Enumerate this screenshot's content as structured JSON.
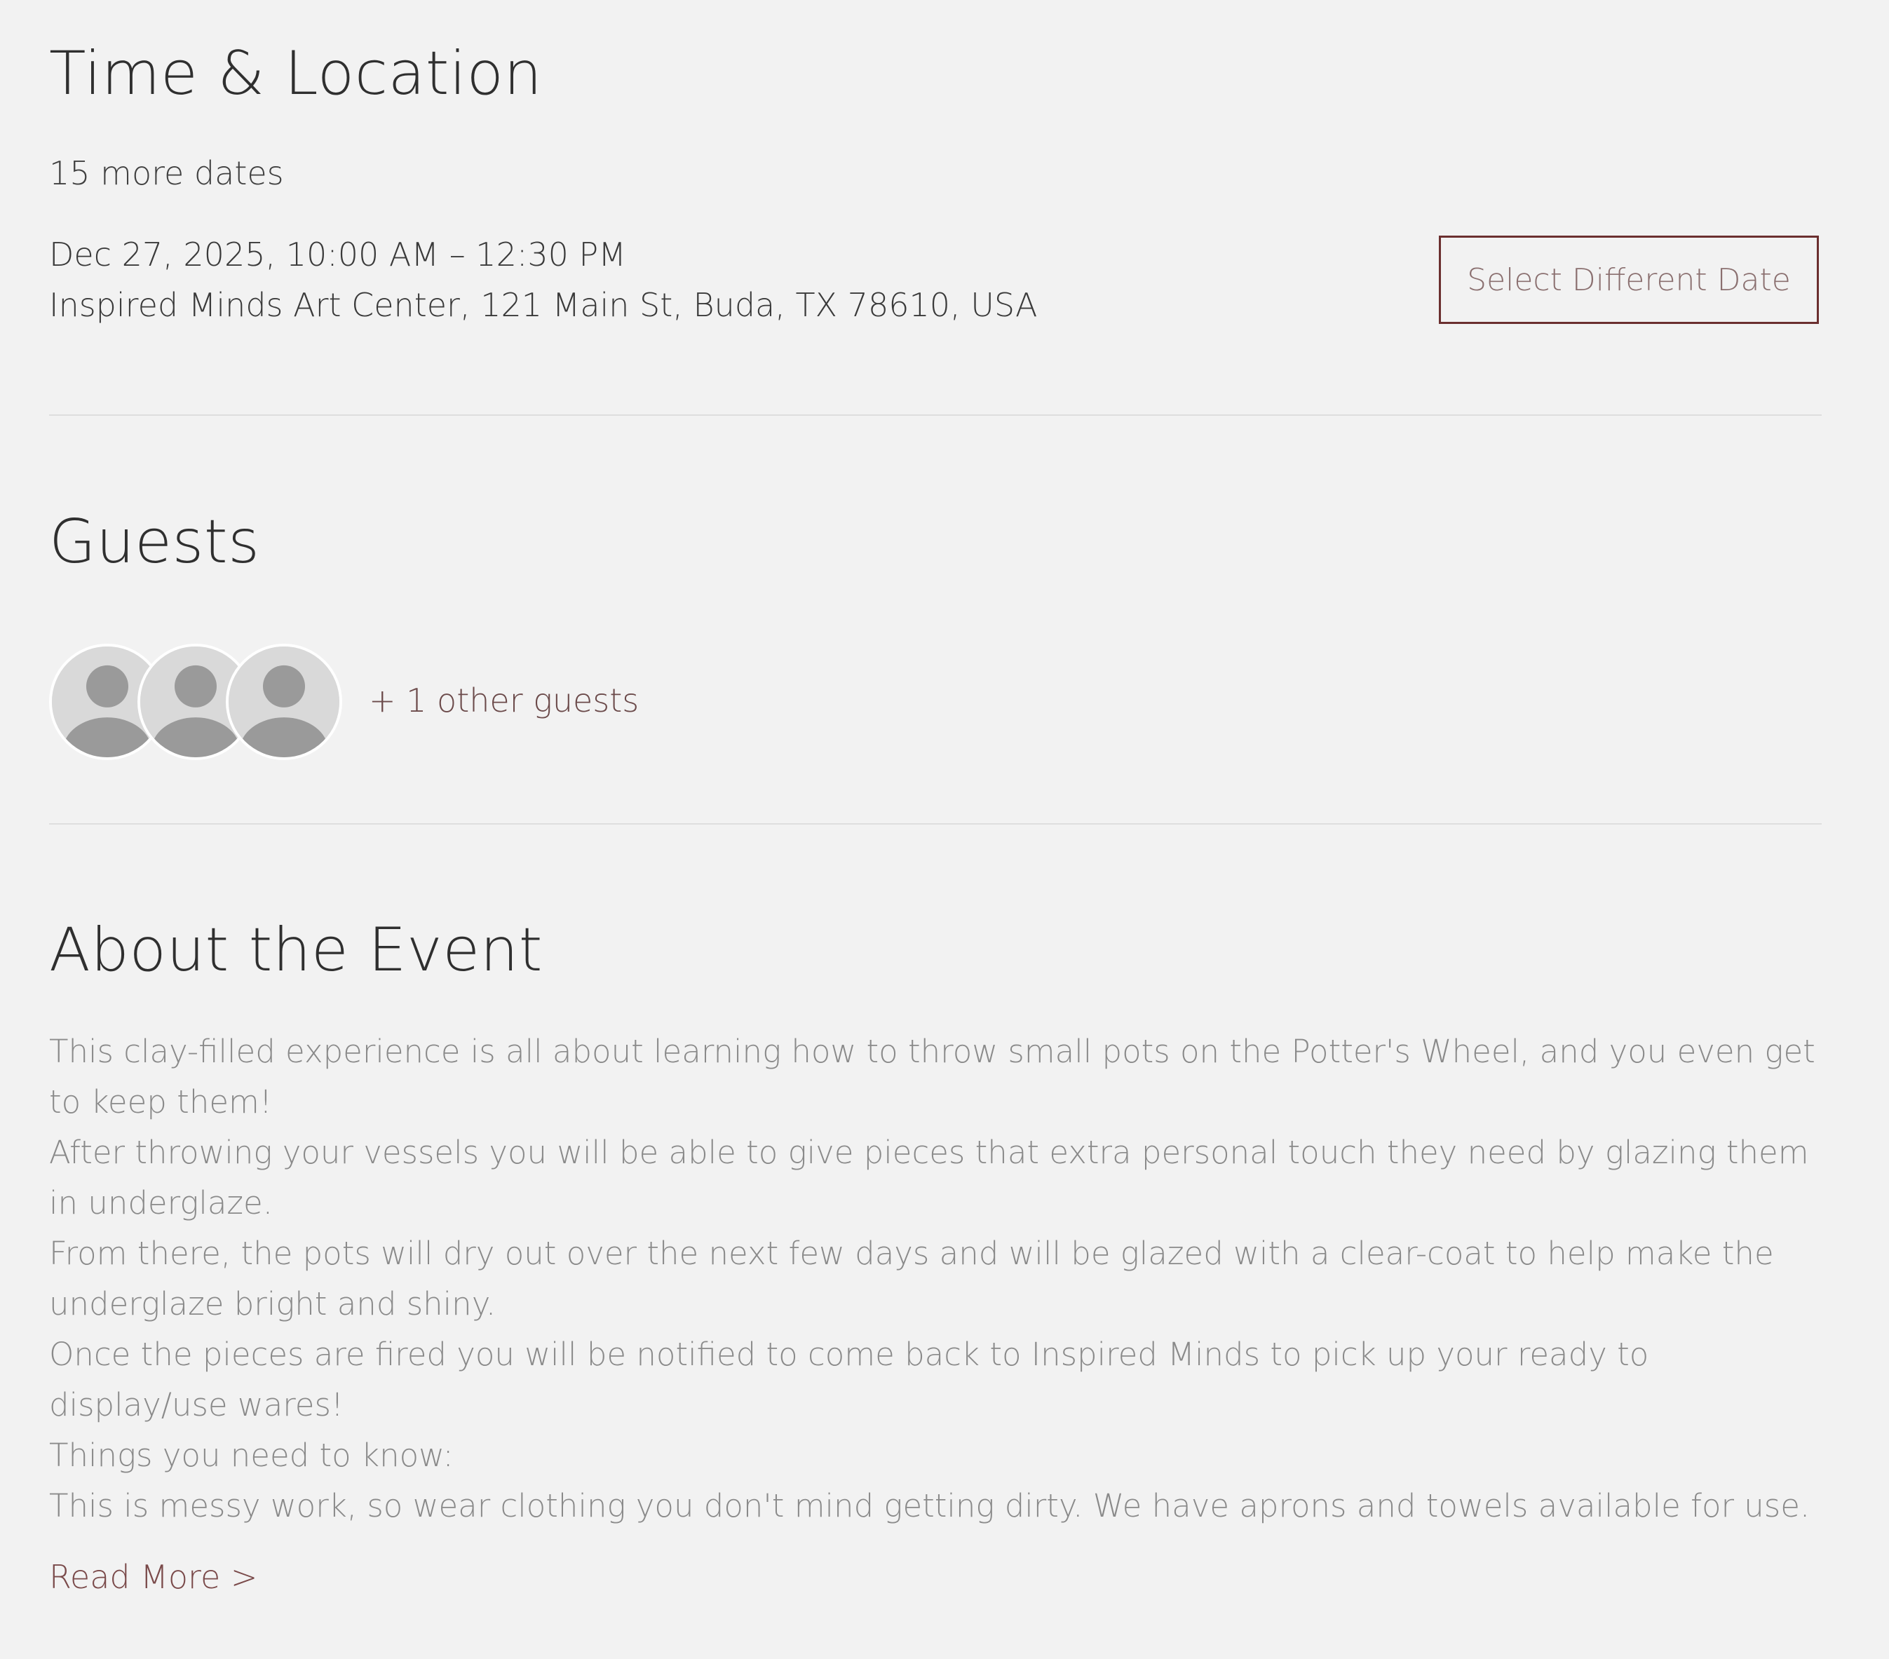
{
  "time_location": {
    "title": "Time & Location",
    "more_dates": "15 more dates",
    "datetime": "Dec 27, 2025, 10:00 AM – 12:30 PM",
    "location": "Inspired Minds Art Center, 121 Main St, Buda, TX 78610, USA",
    "select_date_label": "Select Different Date"
  },
  "guests": {
    "title": "Guests",
    "other_guests": "+ 1 other guests",
    "avatar_icon": "default-user-icon"
  },
  "about": {
    "title": "About the Event",
    "paragraphs": [
      "This clay-filled experience is all about learning how to throw small pots on the Potter's Wheel, and you even get to keep them!",
      "After throwing your vessels you will be able to give pieces that extra personal touch they need by glazing them in underglaze.",
      "From there, the pots will dry out over the next few days and will be glazed with a clear-coat to help make the underglaze bright and shiny.",
      "Once the pieces are fired you will be notified to come back to Inspired Minds to pick up your ready to display/use wares!",
      "Things you need to know:",
      "This is messy work, so wear clothing you don't mind getting dirty. We have aprons and towels available for use."
    ],
    "read_more": "Read More >"
  },
  "colors": {
    "background": "#f2f2f2",
    "accent": "#6b2f2f",
    "body_text": "#8a8a8a"
  }
}
